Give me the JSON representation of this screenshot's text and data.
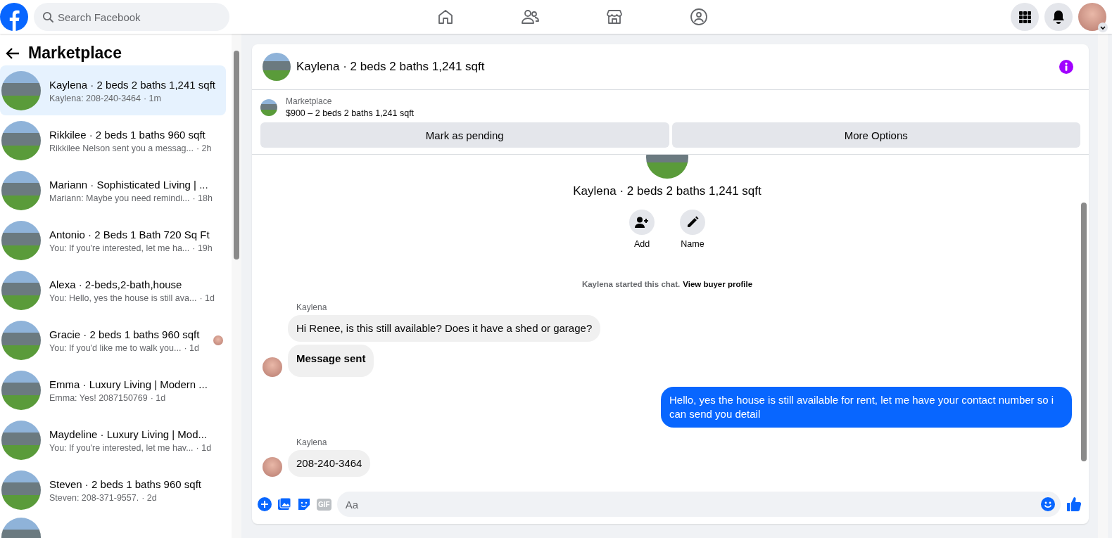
{
  "topbar": {
    "search": {
      "placeholder": "Search Facebook"
    }
  },
  "sidebar": {
    "title": "Marketplace",
    "conversations": [
      {
        "title": "Kaylena · 2 beds 2 baths 1,241 sqft",
        "preview": "Kaylena: 208-240-3464",
        "time": "· 1m",
        "selected": true,
        "seen_avatar": false
      },
      {
        "title": "Rikkilee · 2 beds 1 baths 960 sqft",
        "preview": "Rikkilee Nelson sent you a messag...",
        "time": "· 2h",
        "selected": false,
        "seen_avatar": false
      },
      {
        "title": "Mariann · Sophisticated Living | ...",
        "preview": "Mariann: Maybe you need remindi...",
        "time": "· 18h",
        "selected": false,
        "seen_avatar": false
      },
      {
        "title": "Antonio · 2 Beds 1 Bath 720 Sq Ft",
        "preview": "You: If you're interested, let me ha...",
        "time": "· 19h",
        "selected": false,
        "seen_avatar": false
      },
      {
        "title": "Alexa · 2-beds,2-bath,house",
        "preview": "You: Hello, yes the house is still ava...",
        "time": "· 1d",
        "selected": false,
        "seen_avatar": false
      },
      {
        "title": "Gracie · 2 beds 1 baths 960 sqft",
        "preview": "You: If you'd like me to walk you...",
        "time": "· 1d",
        "selected": false,
        "seen_avatar": true
      },
      {
        "title": "Emma · Luxury Living | Modern ...",
        "preview": "Emma: Yes! 2087150769",
        "time": "· 1d",
        "selected": false,
        "seen_avatar": false
      },
      {
        "title": "Maydeline · Luxury Living | Mod...",
        "preview": "You: If you're interested, let me hav...",
        "time": "· 1d",
        "selected": false,
        "seen_avatar": false
      },
      {
        "title": "Steven · 2 beds 1 baths 960 sqft",
        "preview": "Steven: 208-371-9557.",
        "time": "· 2d",
        "selected": false,
        "seen_avatar": false
      }
    ]
  },
  "chat": {
    "title": "Kaylena · 2 beds 2 baths 1,241 sqft",
    "listing": {
      "label": "Marketplace",
      "text": "$900 – 2 beds 2 baths 1,241 sqft",
      "actions": [
        "Mark as pending",
        "More Options"
      ]
    },
    "intro": {
      "title": "Kaylena · 2 beds 2 baths 1,241 sqft",
      "actions": [
        {
          "kind": "add",
          "label": "Add"
        },
        {
          "kind": "edit",
          "label": "Name"
        }
      ],
      "started_text": "Kaylena started this chat.",
      "profile_link": "View buyer profile"
    },
    "groups": [
      {
        "kind": "incoming",
        "sender": "Kaylena",
        "messages": [
          {
            "kind": "text",
            "text": "Hi Renee, is this still available? Does it have a shed or garage?"
          },
          {
            "kind": "notice",
            "text": "Message sent"
          }
        ]
      },
      {
        "kind": "outgoing",
        "messages": [
          {
            "kind": "text",
            "text": "Hello, yes the house is still available for rent, let me have your contact number so i can send you detail"
          }
        ]
      },
      {
        "kind": "incoming",
        "sender": "Kaylena",
        "messages": [
          {
            "kind": "text",
            "text": "208-240-3464"
          }
        ]
      }
    ],
    "composer": {
      "gif_label": "GIF",
      "placeholder": "Aa"
    }
  }
}
